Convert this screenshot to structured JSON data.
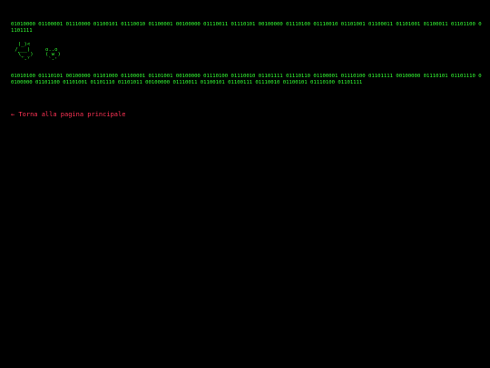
{
  "page": {
    "binary_top": "01010000 01100001 01110000 01100101 01110010 01100001 00100000 01110011 01110101 00100000 01110100 01110010 01101001 01100011 01101001 01100011 01101100 01101111",
    "ascii_art": "  (_)<\n /___)     o..o\n  \\_ _)    ( w )\n   `-'      `-'",
    "binary_bottom": "01010100 01110101 00100000 01101000 01100001 01101001 00100000 01110100 01110010 01101111 01110110 01100001 01110100 01101111 00100000 01110101 01101110 00100000 01101100 01101001 01101110 01101011 00100000 01110011 01100101 01100111 01110010 01100101 01110100 01101111",
    "back_link": "← Torna alla pagina principale"
  },
  "colors": {
    "background": "#000000",
    "text": "#33ff33",
    "link": "#ff3355"
  }
}
